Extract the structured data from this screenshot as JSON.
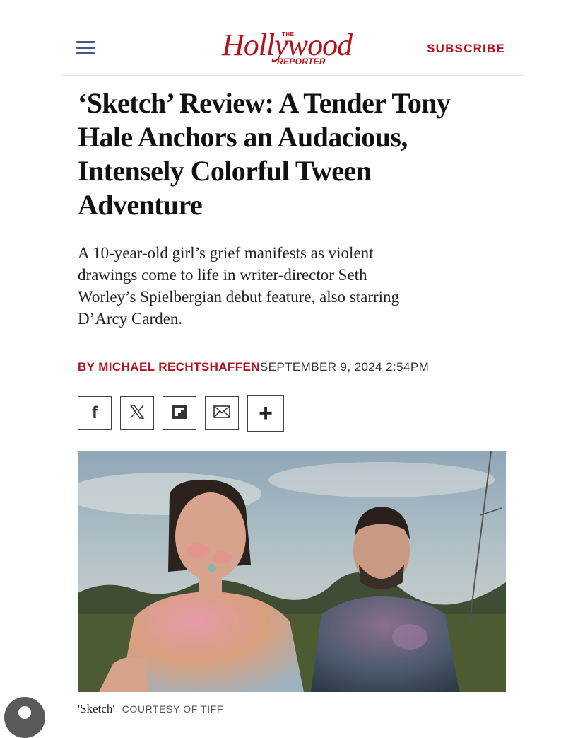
{
  "header": {
    "logo": {
      "the": "THE",
      "name": "Hollywood",
      "reporter": "REPORTER"
    },
    "subscribe_label": "SUBSCRIBE",
    "menu_icon": "hamburger-menu-icon"
  },
  "article": {
    "headline_lines": [
      "‘Sketch’ Review: A Tender Tony",
      "Hale Anchors an Audacious,",
      "Intensely Colorful Tween",
      "Adventure"
    ],
    "dek_lines": [
      "A 10-year-old girl’s grief manifests as violent",
      "drawings come to life in writer-director Seth",
      "Worley’s Spielbergian debut feature, also starring",
      "D’Arcy Carden."
    ],
    "byline_author": "BY MICHAEL RECHTSHAFFEN",
    "byline_date": "SEPTEMBER 9, 2024 2:54PM"
  },
  "share_buttons": [
    {
      "icon": "facebook-icon",
      "glyph": "f"
    },
    {
      "icon": "x-twitter-icon",
      "glyph": "𝕏"
    },
    {
      "icon": "flipboard-icon",
      "glyph": ""
    },
    {
      "icon": "email-icon",
      "glyph": ""
    },
    {
      "icon": "plus-icon",
      "glyph": "+"
    }
  ],
  "photo": {
    "caption_title": "'Sketch'",
    "caption_credit": "COURTESY OF TIFF"
  },
  "colors": {
    "brand_red": "#b5121b",
    "menu_blue": "#3f5b87",
    "text": "#111111"
  }
}
